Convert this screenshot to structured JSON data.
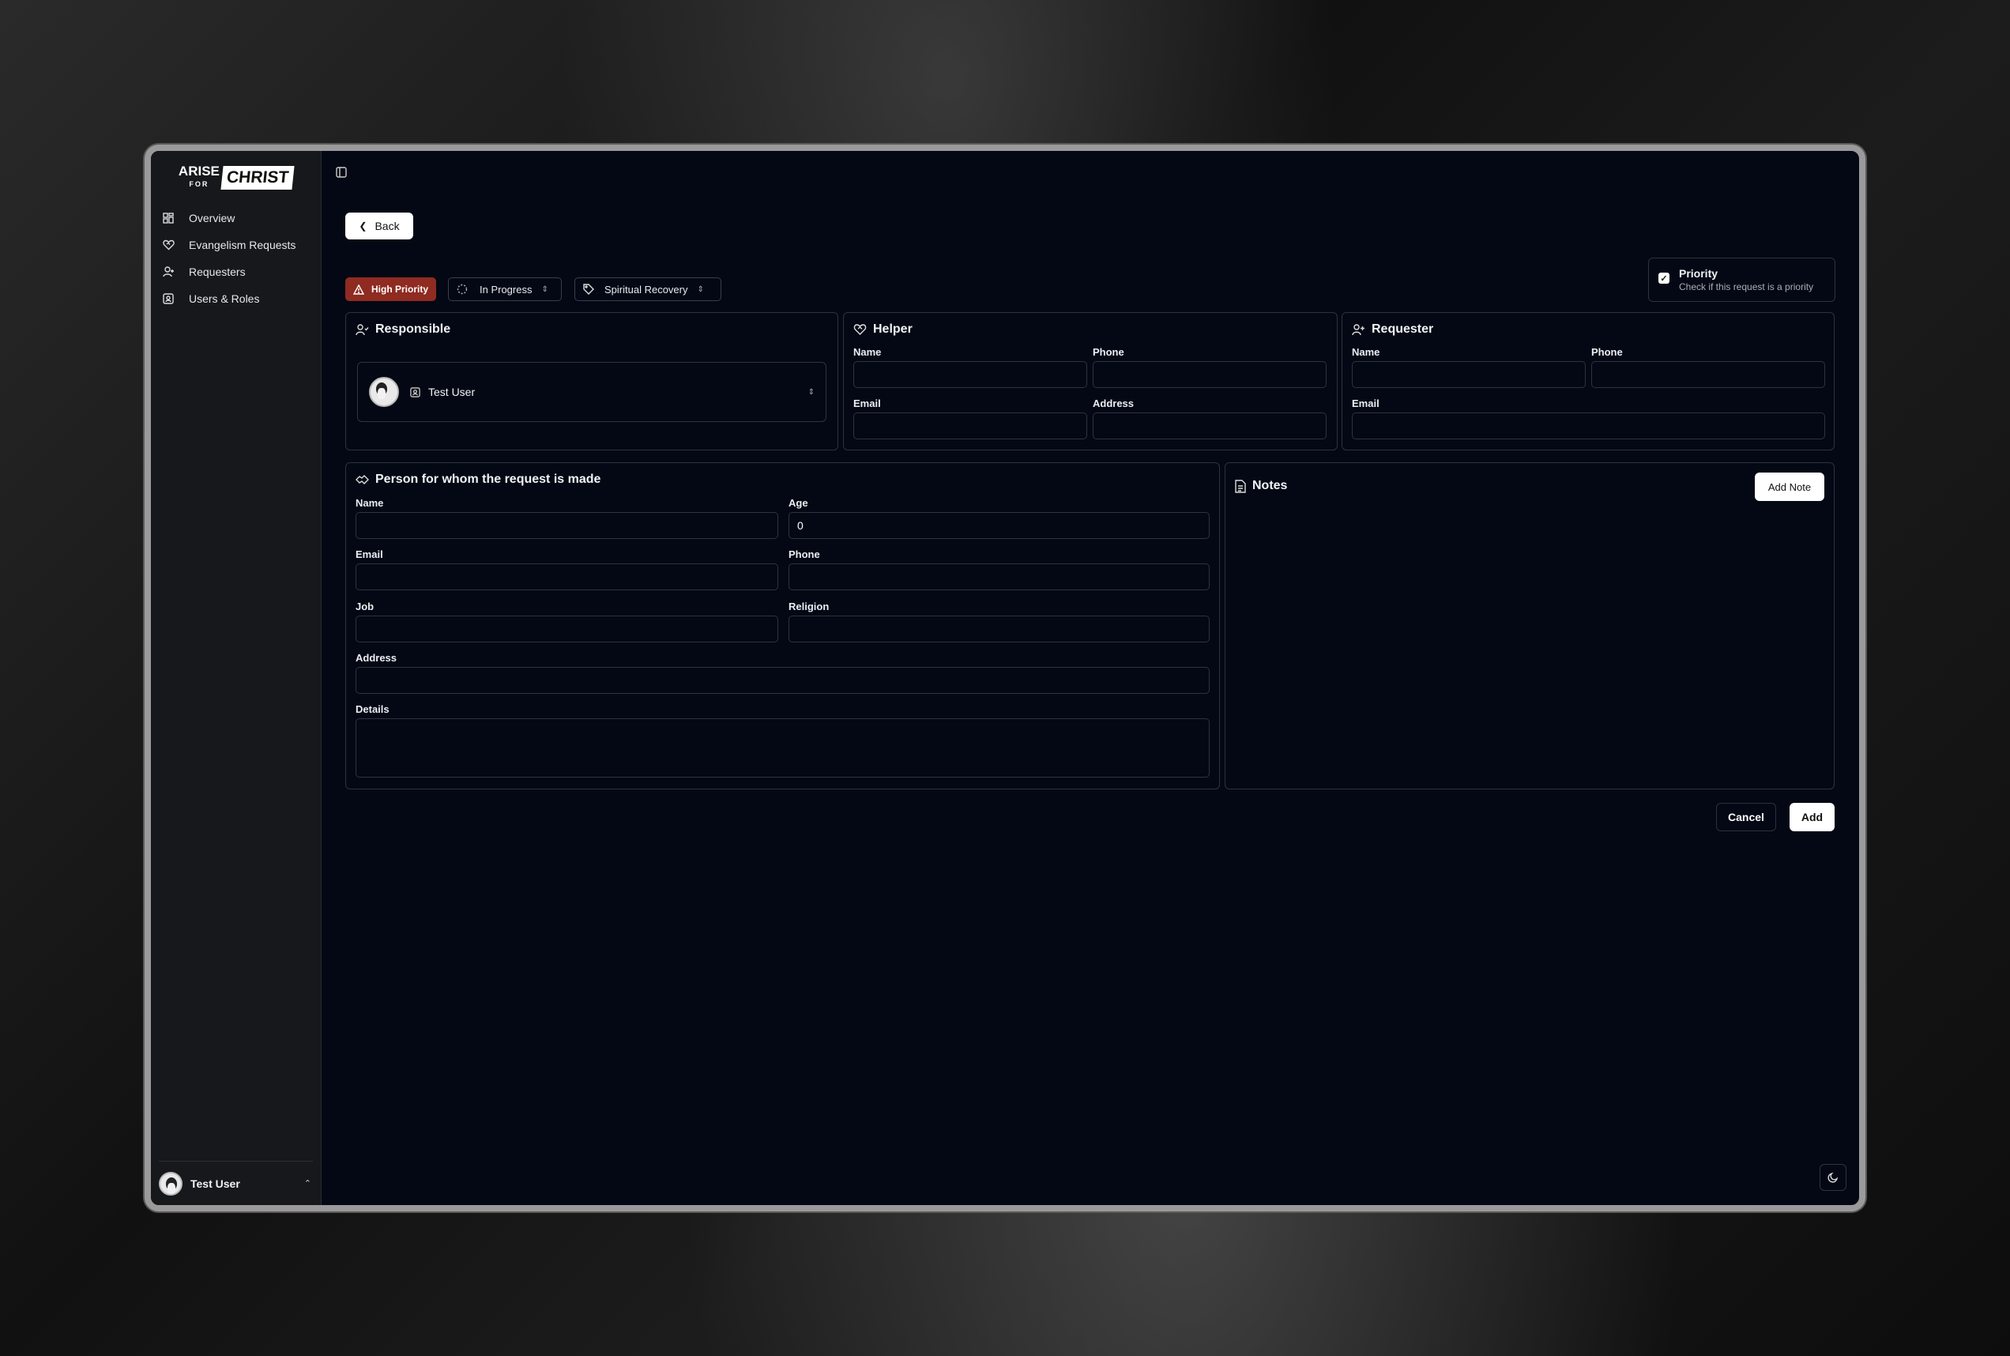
{
  "app": {
    "logo_line1": "ARISE",
    "logo_line1b": "FOR",
    "logo_line2": "CHRIST"
  },
  "sidebar": {
    "items": [
      {
        "label": "Overview",
        "icon": "grid-icon"
      },
      {
        "label": "Evangelism Requests",
        "icon": "heart-handshake-icon"
      },
      {
        "label": "Requesters",
        "icon": "user-plus-icon"
      },
      {
        "label": "Users & Roles",
        "icon": "contact-icon"
      }
    ],
    "user_name": "Test User"
  },
  "toolbar": {
    "back_label": "Back"
  },
  "chips": {
    "priority": "High Priority",
    "status": "In Progress",
    "category": "Spiritual Recovery"
  },
  "priority_checkbox": {
    "title": "Priority",
    "description": "Check if this request is a priority",
    "checked": true
  },
  "responsible": {
    "title": "Responsible",
    "selected_user": "Test User"
  },
  "helper": {
    "title": "Helper",
    "name_label": "Name",
    "phone_label": "Phone",
    "email_label": "Email",
    "address_label": "Address"
  },
  "requester": {
    "title": "Requester",
    "name_label": "Name",
    "phone_label": "Phone",
    "email_label": "Email"
  },
  "person": {
    "title": "Person for whom the request is made",
    "name_label": "Name",
    "age_label": "Age",
    "age_value": "0",
    "email_label": "Email",
    "phone_label": "Phone",
    "job_label": "Job",
    "religion_label": "Religion",
    "address_label": "Address",
    "details_label": "Details"
  },
  "notes": {
    "title": "Notes",
    "add_label": "Add Note"
  },
  "actions": {
    "cancel_label": "Cancel",
    "add_label": "Add"
  },
  "colors": {
    "background": "#030814",
    "high_priority": "#8f2b21",
    "sidebar": "#17181b"
  }
}
